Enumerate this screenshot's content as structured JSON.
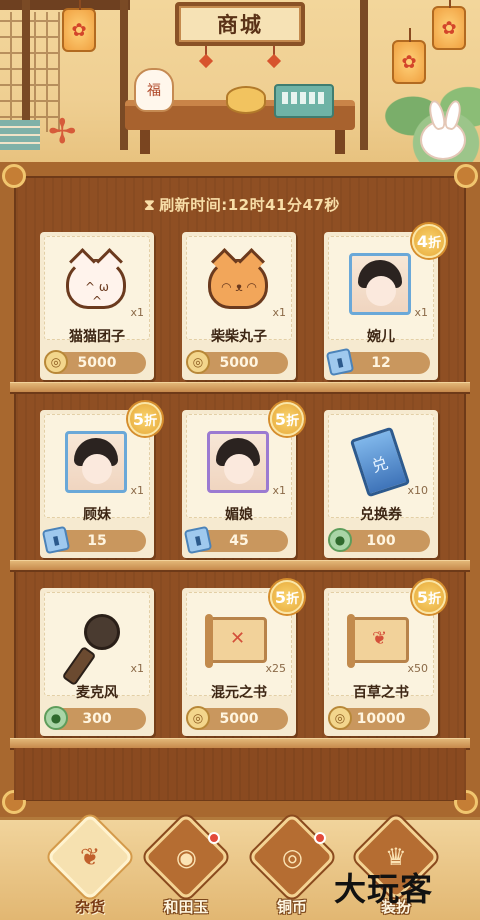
{
  "header": {
    "title": "商城"
  },
  "refresh": {
    "icon": "hourglass-icon",
    "label": "刷新时间:",
    "time": "12时41分47秒"
  },
  "items": [
    {
      "name": "猫猫团子",
      "qty": "x1",
      "price": "5000",
      "currency": "coin",
      "icon": "cat-dumpling-icon",
      "discount": ""
    },
    {
      "name": "柴柴丸子",
      "qty": "x1",
      "price": "5000",
      "currency": "coin",
      "icon": "shiba-dumpling-icon",
      "discount": ""
    },
    {
      "name": "婉儿",
      "qty": "x1",
      "price": "12",
      "currency": "ticket",
      "icon": "character-portrait-icon",
      "discount": "4",
      "discount_suffix": "折"
    },
    {
      "name": "顾妹",
      "qty": "x1",
      "price": "15",
      "currency": "ticket",
      "icon": "character-portrait-icon",
      "discount": "5",
      "discount_suffix": "折"
    },
    {
      "name": "媚娘",
      "qty": "x1",
      "price": "45",
      "currency": "ticket",
      "icon": "character-portrait-icon",
      "discount": "5",
      "discount_suffix": "折"
    },
    {
      "name": "兑换券",
      "qty": "x10",
      "price": "100",
      "currency": "jade",
      "icon": "exchange-ticket-icon",
      "discount": ""
    },
    {
      "name": "麦克风",
      "qty": "x1",
      "price": "300",
      "currency": "jade",
      "icon": "microphone-icon",
      "discount": ""
    },
    {
      "name": "混元之书",
      "qty": "x25",
      "price": "5000",
      "currency": "coin",
      "icon": "scroll-book-icon",
      "discount": "5",
      "discount_suffix": "折"
    },
    {
      "name": "百草之书",
      "qty": "x50",
      "price": "10000",
      "currency": "coin",
      "icon": "scroll-book-icon",
      "discount": "5",
      "discount_suffix": "折"
    }
  ],
  "tabs": [
    {
      "label": "杂货",
      "icon": "leaf-icon",
      "active": true,
      "dot": false
    },
    {
      "label": "和田玉",
      "icon": "jade-icon",
      "active": false,
      "dot": true
    },
    {
      "label": "铜币",
      "icon": "copper-coin-icon",
      "active": false,
      "dot": true
    },
    {
      "label": "装扮",
      "icon": "dress-up-icon",
      "active": false,
      "dot": false
    }
  ],
  "watermark": "大玩客",
  "colors": {
    "shelf": "#8f4f23",
    "accent": "#e7a93a",
    "card": "#f6ead0"
  }
}
